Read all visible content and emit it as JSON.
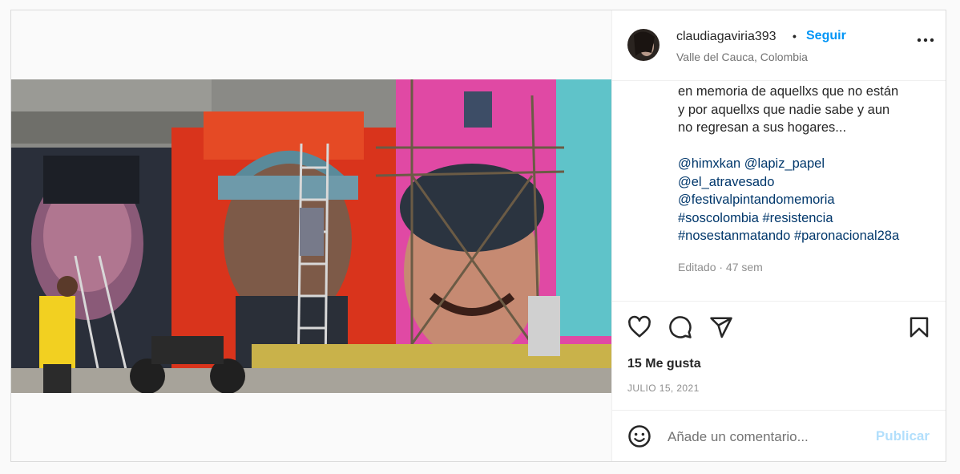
{
  "post": {
    "username": "claudiagaviria393",
    "separator": "•",
    "follow_label": "Seguir",
    "location": "Valle del Cauca, Colombia",
    "caption_text": "en memoria de aquellxs que no están\ny por aquellxs que nadie sabe y aun\nno regresan a sus hogares...",
    "hashtags_text": "@himxkan @lapiz_papel\n@el_atravesado\n@festivalpintandomemoria\n#soscolombia #resistencia\n#nosestanmatando #paronacional28a",
    "edited": "Editado · 47 sem",
    "likes": "15 Me gusta",
    "date": "JULIO 15, 2021"
  },
  "comment": {
    "placeholder": "Añade un comentario...",
    "publish_label": "Publicar"
  },
  "icons": {
    "avatar": "avatar-image",
    "more": "more-options-icon",
    "like": "heart-icon",
    "comment": "comment-bubble-icon",
    "share": "paper-plane-icon",
    "save": "bookmark-icon",
    "emoji": "emoji-icon"
  },
  "colors": {
    "link": "#0095f6",
    "hashtag": "#00376b",
    "publish_disabled": "#b2dffc",
    "muted": "#8e8e8e"
  }
}
